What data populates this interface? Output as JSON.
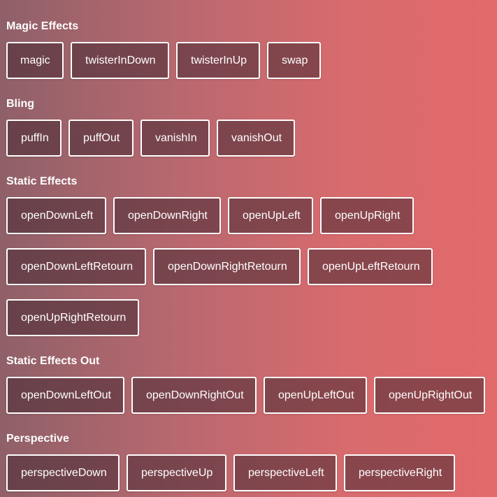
{
  "sections": {
    "magic": {
      "title": "Magic Effects",
      "buttons": [
        "magic",
        "twisterInDown",
        "twisterInUp",
        "swap"
      ]
    },
    "bling": {
      "title": "Bling",
      "buttons": [
        "puffIn",
        "puffOut",
        "vanishIn",
        "vanishOut"
      ]
    },
    "static": {
      "title": "Static Effects",
      "rows": [
        [
          "openDownLeft",
          "openDownRight",
          "openUpLeft",
          "openUpRight"
        ],
        [
          "openDownLeftRetourn",
          "openDownRightRetourn",
          "openUpLeftRetourn"
        ],
        [
          "openUpRightRetourn"
        ]
      ]
    },
    "static_out": {
      "title": "Static Effects Out",
      "buttons": [
        "openDownLeftOut",
        "openDownRightOut",
        "openUpLeftOut",
        "openUpRightOut"
      ]
    },
    "perspective": {
      "title": "Perspective",
      "buttons": [
        "perspectiveDown",
        "perspectiveUp",
        "perspectiveLeft",
        "perspectiveRight"
      ]
    }
  },
  "colors": {
    "background_start": "#8f6068",
    "background_end": "#e26a6a",
    "button_border": "#ffffff",
    "button_text": "#ffffff"
  }
}
